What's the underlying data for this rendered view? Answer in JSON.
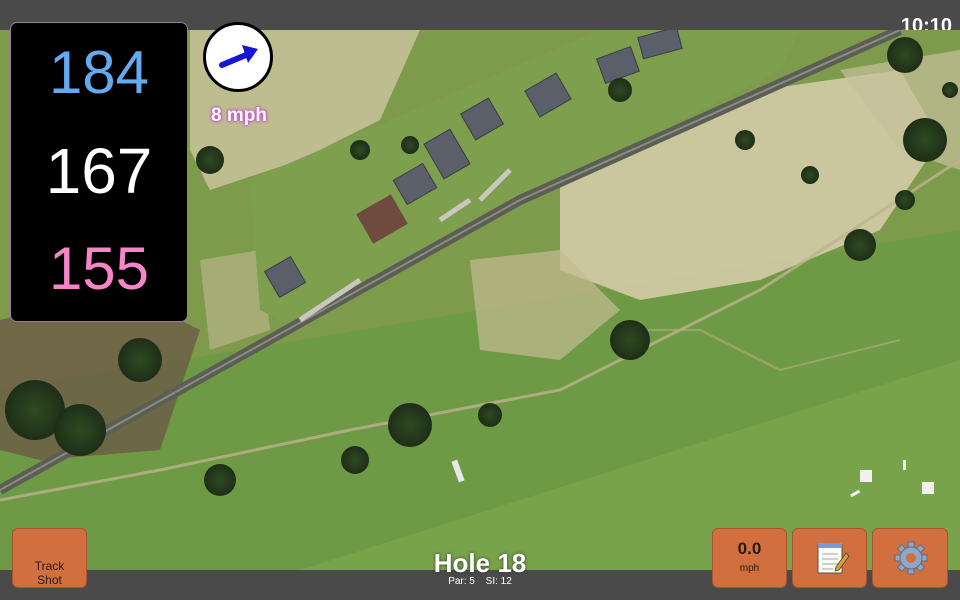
{
  "status": {
    "time": "10:10"
  },
  "yardage": {
    "back": "184",
    "middle": "167",
    "front": "155"
  },
  "wind": {
    "speed": "8 mph",
    "direction_icon": "wind-arrow-icon"
  },
  "buttons": {
    "track_shot": "Track\nShot",
    "speed_value": "0.0",
    "speed_unit": "mph",
    "notes_icon": "notepad-icon",
    "settings_icon": "gear-icon"
  },
  "hole": {
    "title": "Hole 18",
    "par": "Par: 5",
    "si": "SI: 12"
  },
  "colors": {
    "back": "#64aaf0",
    "middle": "#ffffff",
    "front": "#f585c6",
    "button": "#d16f3e",
    "bar": "#4a4a4a"
  }
}
